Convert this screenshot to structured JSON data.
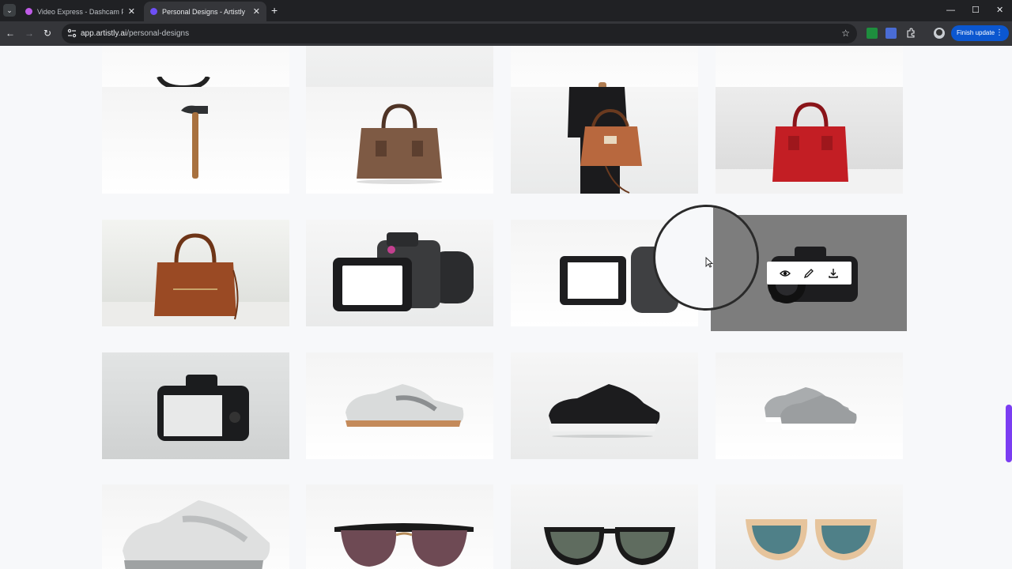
{
  "browser": {
    "tabs": [
      {
        "title": "Video Express - Dashcam Produ",
        "active": false,
        "favicon_color": "#c05ce8"
      },
      {
        "title": "Personal Designs - Artistly",
        "active": true,
        "favicon_color": "#6e4ff5"
      }
    ],
    "new_tab_label": "+",
    "url_host": "app.artistly.ai",
    "url_path": "/personal-designs",
    "finish_update_label": "Finish update",
    "window_controls": {
      "minimize": "—",
      "maximize": "☐",
      "close": "✕"
    }
  },
  "gallery": {
    "items": [
      {
        "subject": "camera"
      },
      {
        "subject": "white-panel"
      },
      {
        "subject": "hammer-handle"
      },
      {
        "subject": "white-panel"
      },
      {
        "subject": "hammer"
      },
      {
        "subject": "brown-handbag"
      },
      {
        "subject": "woman-with-handbag"
      },
      {
        "subject": "red-handbag"
      },
      {
        "subject": "leather-handbag"
      },
      {
        "subject": "dslr-camera"
      },
      {
        "subject": "camera-flip-screen"
      },
      {
        "subject": "dslr-camera-grey"
      },
      {
        "subject": "camera-back"
      },
      {
        "subject": "white-sneaker"
      },
      {
        "subject": "black-sneaker"
      },
      {
        "subject": "grey-sneaker"
      },
      {
        "subject": "white-sneaker-pair"
      },
      {
        "subject": "clubmaster-sunglasses"
      },
      {
        "subject": "black-sunglasses"
      },
      {
        "subject": "tan-sunglasses"
      }
    ],
    "hover_actions": [
      "eye-icon",
      "pencil-icon",
      "download-icon"
    ]
  },
  "colors": {
    "accent": "#7b3df2",
    "update_button": "#0b57d0"
  }
}
